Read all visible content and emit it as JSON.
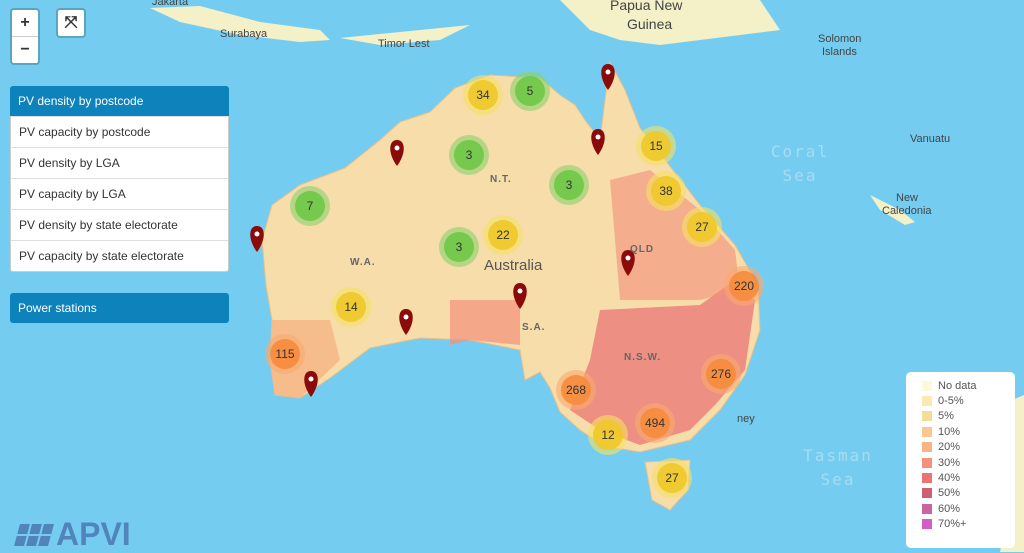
{
  "map": {
    "place_labels": [
      "Jakarta",
      "Surabaya",
      "Timor Lest",
      "Papua New",
      "Guinea",
      "Solomon",
      "Islands",
      "Vanuatu",
      "New",
      "Caledonia",
      "ney"
    ],
    "sea_labels": [
      "Coral Sea",
      "Tasman Sea"
    ],
    "country_label": "Australia",
    "state_labels": [
      "W.A.",
      "N.T.",
      "QLD",
      "S.A.",
      "N.S.W."
    ],
    "ocean_color": "#74cdf0",
    "land_color": "#f4f0c8"
  },
  "controls": {
    "zoom_in": "+",
    "zoom_out": "−",
    "fullscreen_icon": "expand-icon"
  },
  "layers": {
    "active": "PV density by postcode",
    "items": [
      "PV capacity by postcode",
      "PV density by LGA",
      "PV capacity by LGA",
      "PV density by state electorate",
      "PV capacity by state electorate"
    ],
    "power_stations": "Power stations"
  },
  "clusters": [
    34,
    5,
    3,
    15,
    38,
    3,
    7,
    27,
    22,
    3,
    220,
    14,
    115,
    276,
    268,
    494,
    12,
    27
  ],
  "markers_count": 9,
  "legend": [
    {
      "label": "No data",
      "color": "#fdf9dc"
    },
    {
      "label": "0-5%",
      "color": "#fbe9b4"
    },
    {
      "label": "5%",
      "color": "#f5dc9a"
    },
    {
      "label": "10%",
      "color": "#f8c890"
    },
    {
      "label": "20%",
      "color": "#f7b485"
    },
    {
      "label": "30%",
      "color": "#f5907a"
    },
    {
      "label": "40%",
      "color": "#ea7474"
    },
    {
      "label": "50%",
      "color": "#cc6070"
    },
    {
      "label": "60%",
      "color": "#cc64a4"
    },
    {
      "label": "70%+",
      "color": "#d45ec8"
    }
  ],
  "logo": "APVI"
}
